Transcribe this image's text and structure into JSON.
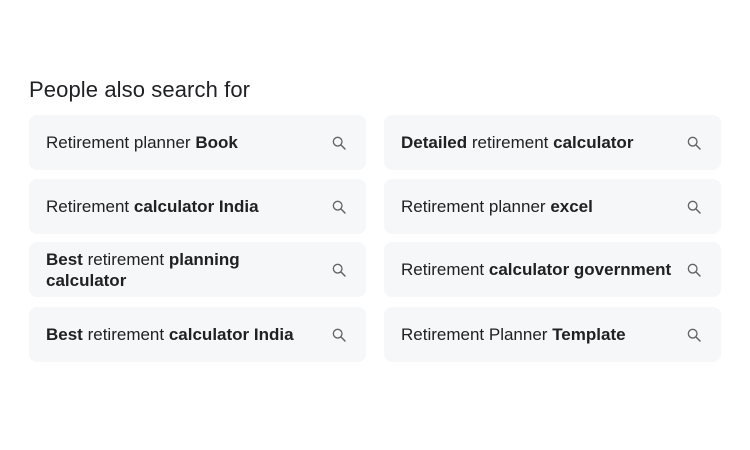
{
  "section": {
    "title": "People also search for"
  },
  "chips": [
    {
      "parts": [
        {
          "t": "Retirement planner ",
          "b": false
        },
        {
          "t": "Book",
          "b": true
        }
      ],
      "icon": "search-icon"
    },
    {
      "parts": [
        {
          "t": "Detailed",
          "b": true
        },
        {
          "t": " retirement ",
          "b": false
        },
        {
          "t": "calculator",
          "b": true
        }
      ],
      "icon": "search-icon"
    },
    {
      "parts": [
        {
          "t": "Retirement ",
          "b": false
        },
        {
          "t": "calculator India",
          "b": true
        }
      ],
      "icon": "search-icon"
    },
    {
      "parts": [
        {
          "t": "Retirement planner ",
          "b": false
        },
        {
          "t": "excel",
          "b": true
        }
      ],
      "icon": "search-icon"
    },
    {
      "parts": [
        {
          "t": "Best",
          "b": true
        },
        {
          "t": " retirement ",
          "b": false
        },
        {
          "t": "planning calculator",
          "b": true
        }
      ],
      "icon": "search-icon"
    },
    {
      "parts": [
        {
          "t": "Retirement ",
          "b": false
        },
        {
          "t": "calculator government",
          "b": true
        }
      ],
      "icon": "search-icon"
    },
    {
      "parts": [
        {
          "t": "Best",
          "b": true
        },
        {
          "t": " retirement ",
          "b": false
        },
        {
          "t": "calculator India",
          "b": true
        }
      ],
      "icon": "search-icon"
    },
    {
      "parts": [
        {
          "t": "Retirement Planner ",
          "b": false
        },
        {
          "t": "Template",
          "b": true
        }
      ],
      "icon": "search-icon"
    }
  ],
  "colors": {
    "chip_bg": "#f6f7f8",
    "text": "#202124",
    "icon": "#5f6368"
  }
}
